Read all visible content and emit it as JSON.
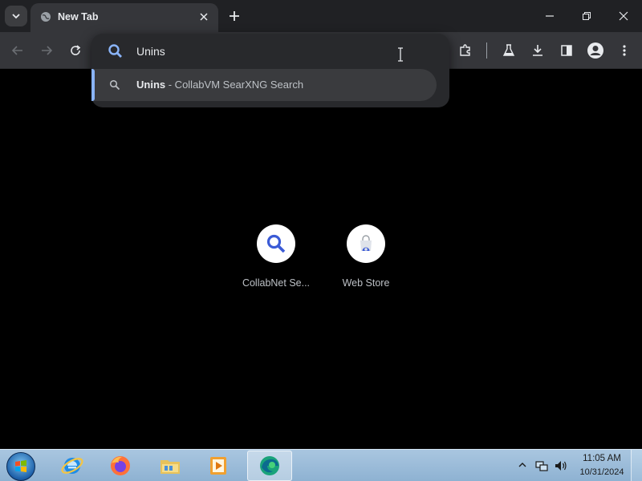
{
  "browser": {
    "tab": {
      "title": "New Tab"
    },
    "omnibox": {
      "value": "Unins",
      "suggestion": {
        "query": "Unins",
        "description": " - CollabVM SearXNG Search"
      }
    },
    "colors": {
      "accent": "#8ab4f8",
      "background": "#000000",
      "toolbar": "#35363a"
    }
  },
  "shortcuts": [
    {
      "label": "CollabNet Se...",
      "icon": "search-icon"
    },
    {
      "label": "Web Store",
      "icon": "web-store-icon"
    }
  ],
  "taskbar": {
    "time": "11:05 AM",
    "date": "10/31/2024",
    "apps": [
      "internet-explorer-icon",
      "firefox-icon",
      "file-explorer-icon",
      "media-player-icon",
      "edge-icon"
    ]
  }
}
